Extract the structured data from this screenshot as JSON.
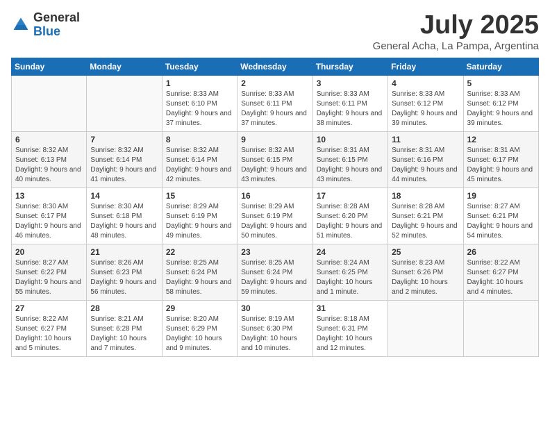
{
  "logo": {
    "general": "General",
    "blue": "Blue"
  },
  "title": "July 2025",
  "subtitle": "General Acha, La Pampa, Argentina",
  "days_header": [
    "Sunday",
    "Monday",
    "Tuesday",
    "Wednesday",
    "Thursday",
    "Friday",
    "Saturday"
  ],
  "weeks": [
    [
      {
        "day": "",
        "sunrise": "",
        "sunset": "",
        "daylight": ""
      },
      {
        "day": "",
        "sunrise": "",
        "sunset": "",
        "daylight": ""
      },
      {
        "day": "1",
        "sunrise": "Sunrise: 8:33 AM",
        "sunset": "Sunset: 6:10 PM",
        "daylight": "Daylight: 9 hours and 37 minutes."
      },
      {
        "day": "2",
        "sunrise": "Sunrise: 8:33 AM",
        "sunset": "Sunset: 6:11 PM",
        "daylight": "Daylight: 9 hours and 37 minutes."
      },
      {
        "day": "3",
        "sunrise": "Sunrise: 8:33 AM",
        "sunset": "Sunset: 6:11 PM",
        "daylight": "Daylight: 9 hours and 38 minutes."
      },
      {
        "day": "4",
        "sunrise": "Sunrise: 8:33 AM",
        "sunset": "Sunset: 6:12 PM",
        "daylight": "Daylight: 9 hours and 39 minutes."
      },
      {
        "day": "5",
        "sunrise": "Sunrise: 8:33 AM",
        "sunset": "Sunset: 6:12 PM",
        "daylight": "Daylight: 9 hours and 39 minutes."
      }
    ],
    [
      {
        "day": "6",
        "sunrise": "Sunrise: 8:32 AM",
        "sunset": "Sunset: 6:13 PM",
        "daylight": "Daylight: 9 hours and 40 minutes."
      },
      {
        "day": "7",
        "sunrise": "Sunrise: 8:32 AM",
        "sunset": "Sunset: 6:14 PM",
        "daylight": "Daylight: 9 hours and 41 minutes."
      },
      {
        "day": "8",
        "sunrise": "Sunrise: 8:32 AM",
        "sunset": "Sunset: 6:14 PM",
        "daylight": "Daylight: 9 hours and 42 minutes."
      },
      {
        "day": "9",
        "sunrise": "Sunrise: 8:32 AM",
        "sunset": "Sunset: 6:15 PM",
        "daylight": "Daylight: 9 hours and 43 minutes."
      },
      {
        "day": "10",
        "sunrise": "Sunrise: 8:31 AM",
        "sunset": "Sunset: 6:15 PM",
        "daylight": "Daylight: 9 hours and 43 minutes."
      },
      {
        "day": "11",
        "sunrise": "Sunrise: 8:31 AM",
        "sunset": "Sunset: 6:16 PM",
        "daylight": "Daylight: 9 hours and 44 minutes."
      },
      {
        "day": "12",
        "sunrise": "Sunrise: 8:31 AM",
        "sunset": "Sunset: 6:17 PM",
        "daylight": "Daylight: 9 hours and 45 minutes."
      }
    ],
    [
      {
        "day": "13",
        "sunrise": "Sunrise: 8:30 AM",
        "sunset": "Sunset: 6:17 PM",
        "daylight": "Daylight: 9 hours and 46 minutes."
      },
      {
        "day": "14",
        "sunrise": "Sunrise: 8:30 AM",
        "sunset": "Sunset: 6:18 PM",
        "daylight": "Daylight: 9 hours and 48 minutes."
      },
      {
        "day": "15",
        "sunrise": "Sunrise: 8:29 AM",
        "sunset": "Sunset: 6:19 PM",
        "daylight": "Daylight: 9 hours and 49 minutes."
      },
      {
        "day": "16",
        "sunrise": "Sunrise: 8:29 AM",
        "sunset": "Sunset: 6:19 PM",
        "daylight": "Daylight: 9 hours and 50 minutes."
      },
      {
        "day": "17",
        "sunrise": "Sunrise: 8:28 AM",
        "sunset": "Sunset: 6:20 PM",
        "daylight": "Daylight: 9 hours and 51 minutes."
      },
      {
        "day": "18",
        "sunrise": "Sunrise: 8:28 AM",
        "sunset": "Sunset: 6:21 PM",
        "daylight": "Daylight: 9 hours and 52 minutes."
      },
      {
        "day": "19",
        "sunrise": "Sunrise: 8:27 AM",
        "sunset": "Sunset: 6:21 PM",
        "daylight": "Daylight: 9 hours and 54 minutes."
      }
    ],
    [
      {
        "day": "20",
        "sunrise": "Sunrise: 8:27 AM",
        "sunset": "Sunset: 6:22 PM",
        "daylight": "Daylight: 9 hours and 55 minutes."
      },
      {
        "day": "21",
        "sunrise": "Sunrise: 8:26 AM",
        "sunset": "Sunset: 6:23 PM",
        "daylight": "Daylight: 9 hours and 56 minutes."
      },
      {
        "day": "22",
        "sunrise": "Sunrise: 8:25 AM",
        "sunset": "Sunset: 6:24 PM",
        "daylight": "Daylight: 9 hours and 58 minutes."
      },
      {
        "day": "23",
        "sunrise": "Sunrise: 8:25 AM",
        "sunset": "Sunset: 6:24 PM",
        "daylight": "Daylight: 9 hours and 59 minutes."
      },
      {
        "day": "24",
        "sunrise": "Sunrise: 8:24 AM",
        "sunset": "Sunset: 6:25 PM",
        "daylight": "Daylight: 10 hours and 1 minute."
      },
      {
        "day": "25",
        "sunrise": "Sunrise: 8:23 AM",
        "sunset": "Sunset: 6:26 PM",
        "daylight": "Daylight: 10 hours and 2 minutes."
      },
      {
        "day": "26",
        "sunrise": "Sunrise: 8:22 AM",
        "sunset": "Sunset: 6:27 PM",
        "daylight": "Daylight: 10 hours and 4 minutes."
      }
    ],
    [
      {
        "day": "27",
        "sunrise": "Sunrise: 8:22 AM",
        "sunset": "Sunset: 6:27 PM",
        "daylight": "Daylight: 10 hours and 5 minutes."
      },
      {
        "day": "28",
        "sunrise": "Sunrise: 8:21 AM",
        "sunset": "Sunset: 6:28 PM",
        "daylight": "Daylight: 10 hours and 7 minutes."
      },
      {
        "day": "29",
        "sunrise": "Sunrise: 8:20 AM",
        "sunset": "Sunset: 6:29 PM",
        "daylight": "Daylight: 10 hours and 9 minutes."
      },
      {
        "day": "30",
        "sunrise": "Sunrise: 8:19 AM",
        "sunset": "Sunset: 6:30 PM",
        "daylight": "Daylight: 10 hours and 10 minutes."
      },
      {
        "day": "31",
        "sunrise": "Sunrise: 8:18 AM",
        "sunset": "Sunset: 6:31 PM",
        "daylight": "Daylight: 10 hours and 12 minutes."
      },
      {
        "day": "",
        "sunrise": "",
        "sunset": "",
        "daylight": ""
      },
      {
        "day": "",
        "sunrise": "",
        "sunset": "",
        "daylight": ""
      }
    ]
  ]
}
